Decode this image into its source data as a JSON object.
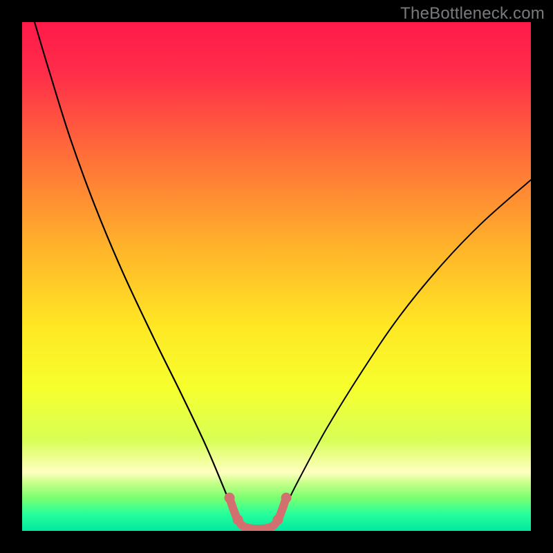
{
  "watermark": "TheBottleneck.com",
  "chart_data": {
    "type": "line",
    "title": "",
    "xlabel": "",
    "ylabel": "",
    "xlim": [
      0,
      736
    ],
    "ylim": [
      100,
      0
    ],
    "gradient_stops": [
      {
        "offset": 0.0,
        "color": "#ff1a4a"
      },
      {
        "offset": 0.1,
        "color": "#ff2d4a"
      },
      {
        "offset": 0.25,
        "color": "#ff6a3a"
      },
      {
        "offset": 0.45,
        "color": "#ffb62a"
      },
      {
        "offset": 0.6,
        "color": "#ffe824"
      },
      {
        "offset": 0.72,
        "color": "#f6ff2e"
      },
      {
        "offset": 0.82,
        "color": "#d8ff55"
      },
      {
        "offset": 0.885,
        "color": "#ffffc0"
      },
      {
        "offset": 0.905,
        "color": "#c8ff8a"
      },
      {
        "offset": 0.935,
        "color": "#7bff70"
      },
      {
        "offset": 0.965,
        "color": "#2aff9a"
      },
      {
        "offset": 1.0,
        "color": "#00e8a0"
      }
    ],
    "series": [
      {
        "name": "curve-left",
        "stroke": "#000000",
        "stroke_width": 2.2,
        "points": [
          {
            "x": 18,
            "y": 100.0
          },
          {
            "x": 40,
            "y": 90.0
          },
          {
            "x": 70,
            "y": 77.0
          },
          {
            "x": 105,
            "y": 64.0
          },
          {
            "x": 145,
            "y": 51.0
          },
          {
            "x": 190,
            "y": 38.0
          },
          {
            "x": 230,
            "y": 27.0
          },
          {
            "x": 265,
            "y": 17.0
          },
          {
            "x": 290,
            "y": 9.0
          },
          {
            "x": 305,
            "y": 4.0
          }
        ]
      },
      {
        "name": "curve-right",
        "stroke": "#000000",
        "stroke_width": 2.0,
        "points": [
          {
            "x": 378,
            "y": 4.0
          },
          {
            "x": 400,
            "y": 10.0
          },
          {
            "x": 440,
            "y": 20.0
          },
          {
            "x": 490,
            "y": 31.0
          },
          {
            "x": 545,
            "y": 42.0
          },
          {
            "x": 605,
            "y": 52.0
          },
          {
            "x": 665,
            "y": 60.5
          },
          {
            "x": 736,
            "y": 69.0
          }
        ]
      },
      {
        "name": "link-shape",
        "stroke": "#d27070",
        "stroke_width": 12,
        "points": [
          {
            "x": 300,
            "y": 6.5
          },
          {
            "x": 312,
            "y": 2.2
          },
          {
            "x": 326,
            "y": 0.6
          },
          {
            "x": 356,
            "y": 0.6
          },
          {
            "x": 370,
            "y": 2.2
          },
          {
            "x": 382,
            "y": 6.5
          }
        ],
        "dots": [
          {
            "x": 300,
            "y": 6.5
          },
          {
            "x": 312,
            "y": 2.2
          },
          {
            "x": 370,
            "y": 2.2
          },
          {
            "x": 382,
            "y": 6.5
          }
        ]
      }
    ]
  }
}
